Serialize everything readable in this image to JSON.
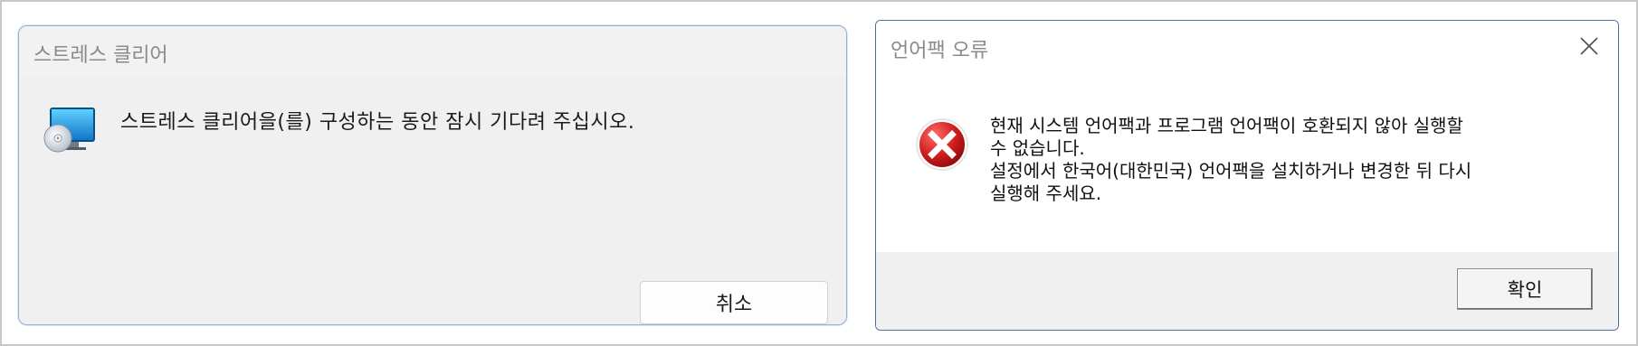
{
  "dialog_left": {
    "title": "스트레스 클리어",
    "message": "스트레스 클리어을(를) 구성하는 동안 잠시 기다려 주십시오.",
    "cancel_label": "취소",
    "icon": "computer-disc-icon"
  },
  "dialog_right": {
    "title": "언어팩 오류",
    "message_lines": [
      "현재 시스템 언어팩과 프로그램 언어팩이 호환되지 않아 실행할",
      "수 없습니다.",
      "설정에서 한국어(대한민국) 언어팩을 설치하거나 변경한 뒤 다시",
      "실행해 주세요."
    ],
    "ok_label": "확인",
    "icon": "error-x-icon"
  },
  "colors": {
    "error_red": "#c8102e",
    "border_blue": "#4a6fa5"
  }
}
